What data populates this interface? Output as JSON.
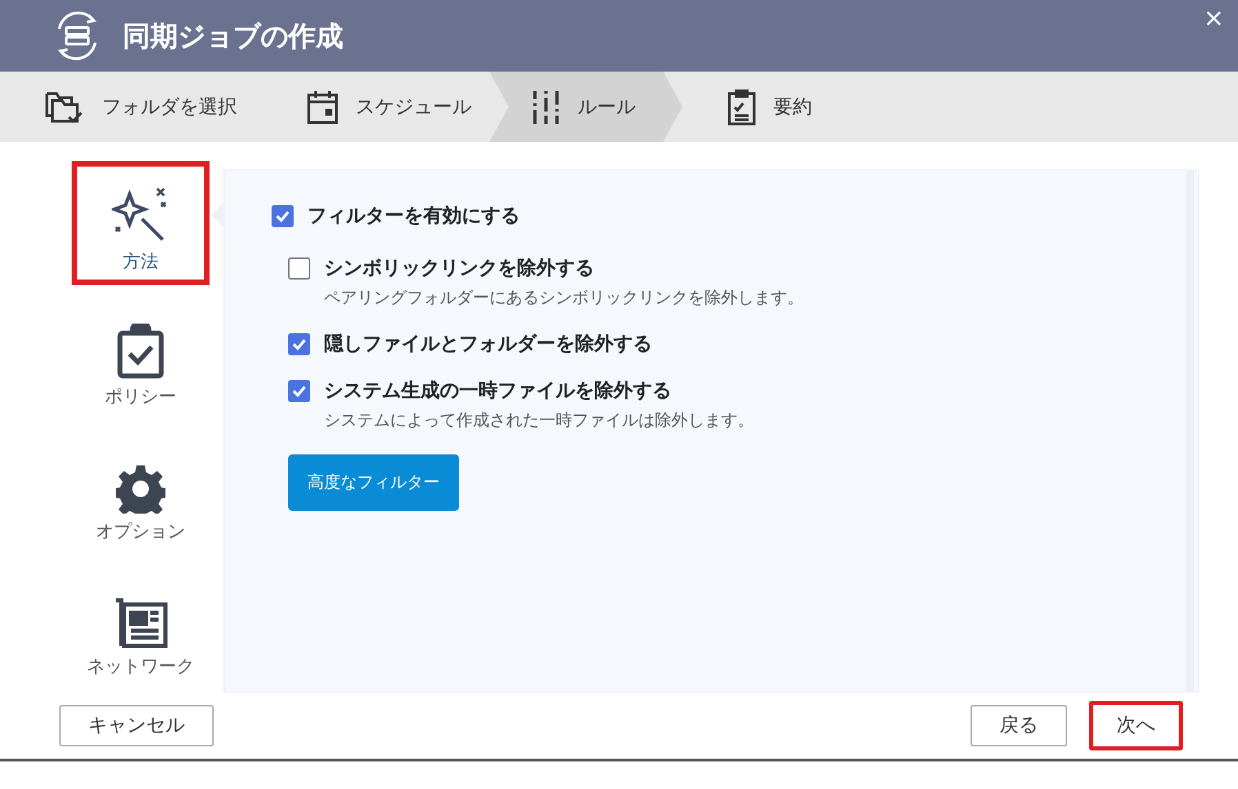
{
  "window": {
    "title": "同期ジョブの作成",
    "close": "×"
  },
  "steps": [
    {
      "label": "フォルダを選択",
      "kind": "folder",
      "selected": false
    },
    {
      "label": "スケジュール",
      "kind": "calendar",
      "selected": false
    },
    {
      "label": "ルール",
      "kind": "sliders",
      "selected": true
    },
    {
      "label": "要約",
      "kind": "clipboard",
      "selected": false
    }
  ],
  "sidebar": {
    "items": [
      {
        "label": "方法",
        "kind": "wand",
        "selected": true,
        "highlighted": true
      },
      {
        "label": "ポリシー",
        "kind": "clipboard-check",
        "selected": false,
        "highlighted": false
      },
      {
        "label": "オプション",
        "kind": "gear",
        "selected": false,
        "highlighted": false
      },
      {
        "label": "ネットワーク",
        "kind": "network",
        "selected": false,
        "highlighted": false
      }
    ]
  },
  "filters": {
    "enable": {
      "label": "フィルターを有効にする",
      "checked": true
    },
    "options": [
      {
        "label": "シンボリックリンクを除外する",
        "description": "ペアリングフォルダーにあるシンボリックリンクを除外します。",
        "checked": false
      },
      {
        "label": "隠しファイルとフォルダーを除外する",
        "checked": true
      },
      {
        "label": "システム生成の一時ファイルを除外する",
        "description": "システムによって作成された一時ファイルは除外します。",
        "checked": true
      }
    ],
    "advanced_button": "高度なフィルター"
  },
  "footer": {
    "cancel": "キャンセル",
    "back": "戻る",
    "next": {
      "label": "次へ",
      "highlighted": true
    }
  }
}
